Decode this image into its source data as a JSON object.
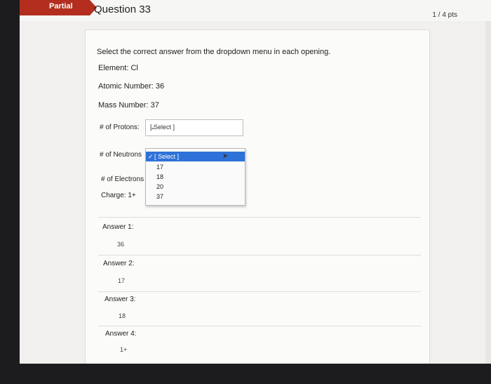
{
  "header": {
    "status_badge": "Partial",
    "question_title": "Question 33",
    "points": "1 / 4 pts"
  },
  "question": {
    "prompt": "Select the correct answer from the dropdown menu in each opening.",
    "element": "Element: Cl",
    "atomic_number": "Atomic Number: 36",
    "mass_number": "Mass Number: 37",
    "protons_label": "# of Protons:",
    "protons_select": "[ Select ]",
    "neutrons_label": "# of Neutrons",
    "electrons_label": "# of Electrons",
    "charge": "Charge: 1+"
  },
  "dropdown": {
    "selected": "[ Select ]",
    "options": [
      "17",
      "18",
      "20",
      "37"
    ]
  },
  "answers": [
    {
      "label": "Answer 1:",
      "value": "36"
    },
    {
      "label": "Answer 2:",
      "value": "17"
    },
    {
      "label": "Answer 3:",
      "value": "18"
    },
    {
      "label": "Answer 4:",
      "value": "1+"
    }
  ]
}
